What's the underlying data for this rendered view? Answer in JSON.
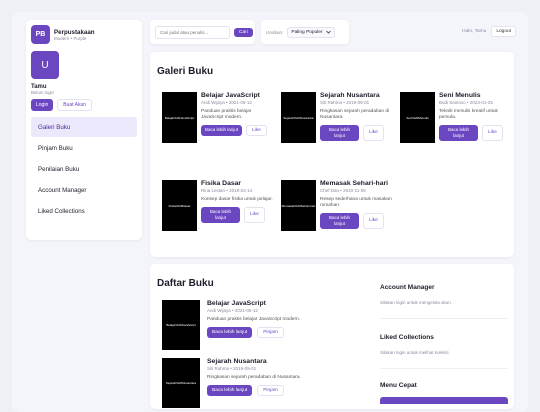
{
  "brand": {
    "logo": "PB",
    "name": "Perpustakaan",
    "subtitle": "Modern • Purple"
  },
  "user": {
    "avatar": "U",
    "name": "Tamu",
    "status": "Belum login",
    "login": "Login",
    "register": "Buat Akun"
  },
  "nav": [
    {
      "label": "Galeri Buku",
      "active": true
    },
    {
      "label": "Pinjam Buku"
    },
    {
      "label": "Penilaian Buku"
    },
    {
      "label": "Account Manager"
    },
    {
      "label": "Liked Collections"
    }
  ],
  "search": {
    "placeholder": "Cari judul atau penulis...",
    "button": "Cari"
  },
  "sort": {
    "label": "Urutkan:",
    "value": "Paling Populer"
  },
  "topbar": {
    "greeting": "Halo, Tamu",
    "logout": "Logout"
  },
  "gallery": {
    "title": "Galeri Buku",
    "items": [
      {
        "cover": "Belajar%20JavaScript",
        "title": "Belajar JavaScript",
        "meta": "Andi Wijaya • 2021-06-12",
        "desc": "Panduan praktis belajar JavaScript modern.",
        "read": "Baca lebih lanjut",
        "like": "Like"
      },
      {
        "cover": "Sejarah%20Nusantara",
        "title": "Sejarah Nusantara",
        "meta": "Siti Rahma • 2019-09-01",
        "desc": "Ringkasan sejarah peradaban di Nusantara.",
        "read": "Baca lebih lanjut",
        "like": "Like"
      },
      {
        "cover": "Seni%20Menulis",
        "title": "Seni Menulis",
        "meta": "Budi Santoso • 2023-01-25",
        "desc": "Teknik menulis kreatif untuk pemula.",
        "read": "Baca lebih lanjut",
        "like": "Like"
      },
      {
        "cover": "Fisika%20Dasar",
        "title": "Fisika Dasar",
        "meta": "Rina Lestari • 2018-03-14",
        "desc": "Konsep dasar fisika untuk pelajar.",
        "read": "Baca lebih lanjut",
        "like": "Like"
      },
      {
        "cover": "Memasak%20Sehari-hari",
        "title": "Memasak Sehari-hari",
        "meta": "Chef Dan • 2020-11-08",
        "desc": "Resep sederhana untuk masakan rumahan.",
        "read": "Baca lebih lanjut",
        "like": "Like"
      }
    ]
  },
  "list": {
    "title": "Daftar Buku",
    "items": [
      {
        "cover": "Belajar%20JavaScript",
        "title": "Belajar JavaScript",
        "meta": "Andi Wijaya • 2021-06-12",
        "desc": "Panduan praktis belajar JavaScript modern.",
        "read": "Baca lebih lanjut",
        "borrow": "Pinjam"
      },
      {
        "cover": "Sejarah%20Nusantara",
        "title": "Sejarah Nusantara",
        "meta": "Siti Rahma • 2019-09-01",
        "desc": "Ringkasan sejarah peradaban di Nusantara.",
        "read": "Baca lebih lanjut",
        "borrow": "Pinjam"
      }
    ]
  },
  "right": {
    "account_title": "Account Manager",
    "account_text": "Silakan login untuk mengelola akun.",
    "liked_title": "Liked Collections",
    "liked_text": "Silakan login untuk melihat koleksi.",
    "quick_title": "Menu Cepat"
  },
  "colors": {
    "accent": "#6b46c1",
    "active_nav": "#ece8fb",
    "cover": "#000000"
  }
}
